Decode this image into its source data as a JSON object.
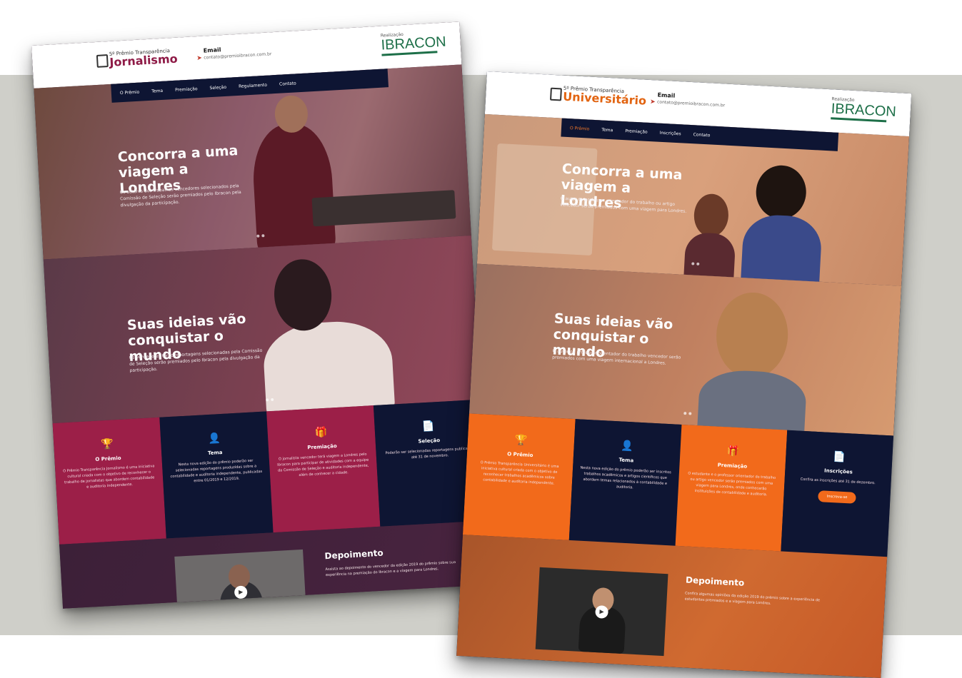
{
  "canvas": {
    "background": "#cfcfc9"
  },
  "site_jornalismo": {
    "logo_small": "5º Prêmio Transparência",
    "logo_big": "Jornalismo",
    "email_label": "Email",
    "email_value": "contato@premioibracon.com.br",
    "sponsor_label": "Realização",
    "sponsor_name": "IBRACON",
    "nav": [
      "O Prêmio",
      "Tema",
      "Premiação",
      "Seleção",
      "Regulamento",
      "Contato"
    ],
    "hero1": {
      "title": "Concorra a uma viagem a Londres",
      "subtitle": "Os autores dos trabalhos vencedores selecionados pela Comissão de Seleção serão premiados pelo Ibracon pela divulgação da participação."
    },
    "hero2": {
      "title": "Suas ideias vão conquistar o mundo",
      "subtitle": "Os vencedores terão reportagens selecionadas pela Comissão de Seleção serão premiados pelo Ibracon pela divulgação da participação."
    },
    "features": [
      {
        "icon": "trophy",
        "title": "O Prêmio",
        "text": "O Prêmio Transparência Jornalismo é uma iniciativa cultural criada com o objetivo de reconhecer o trabalho de jornalistas que abordem contabilidade e auditoria independente."
      },
      {
        "icon": "person",
        "title": "Tema",
        "text": "Nesta nova edição do prêmio poderão ser selecionadas reportagens produzidas sobre a contabilidade e auditoria independente, publicadas entre 01/2019 e 12/2019."
      },
      {
        "icon": "gift",
        "title": "Premiação",
        "text": "O jornalista vencedor terá viagem a Londres pelo Ibracon para participar de atividades com a equipe da Comissão de Seleção e auditoria independente, além de conhecer a cidade."
      },
      {
        "icon": "document",
        "title": "Seleção",
        "text": "Poderão ser selecionadas reportagens publicadas até 31 de novembro."
      }
    ],
    "testimonial": {
      "title": "Depoimento",
      "text": "Assista ao depoimento do vencedor da edição 2019 do prêmio sobre sua experiência na premiação do Ibracon e a viagem para Londres."
    }
  },
  "site_universitario": {
    "logo_small": "5º Prêmio Transparência",
    "logo_big": "Universitário",
    "email_label": "Email",
    "email_value": "contato@premioibracon.com.br",
    "sponsor_label": "Realização",
    "sponsor_name": "IBRACON",
    "nav": [
      "O Prêmio",
      "Tema",
      "Premiação",
      "Inscrições",
      "Contato"
    ],
    "hero1": {
      "title": "Concorra a uma viagem a Londres",
      "subtitle": "O autor ou professor orientador do trabalho ou artigo vencedor serão premiados com uma viagem para Londres."
    },
    "hero2": {
      "title": "Suas ideias vão conquistar o mundo",
      "subtitle": "O autor ou professor orientador do trabalho vencedor serão premiados com uma viagem internacional a Londres."
    },
    "features": [
      {
        "icon": "trophy",
        "title": "O Prêmio",
        "text": "O Prêmio Transparência Universitário é uma iniciativa cultural criada com o objetivo de reconhecer trabalhos acadêmicos sobre contabilidade e auditoria independente."
      },
      {
        "icon": "person",
        "title": "Tema",
        "text": "Nesta nova edição do prêmio poderão ser inscritos trabalhos acadêmicos e artigos científicos que abordem temas relacionados à contabilidade e auditoria."
      },
      {
        "icon": "gift",
        "title": "Premiação",
        "text": "O estudante e o professor orientador do trabalho ou artigo vencedor serão premiados com uma viagem para Londres, onde conhecerão instituições de contabilidade e auditoria."
      },
      {
        "icon": "document",
        "title": "Inscrições",
        "text": "Confira as inscrições até 31 de dezembro.",
        "button": "Inscreva-se"
      }
    ],
    "testimonial": {
      "title": "Depoimento",
      "text": "Confira algumas opiniões da edição 2019 do prêmio sobre a experiência de estudantes premiados e a viagem para Londres."
    }
  }
}
